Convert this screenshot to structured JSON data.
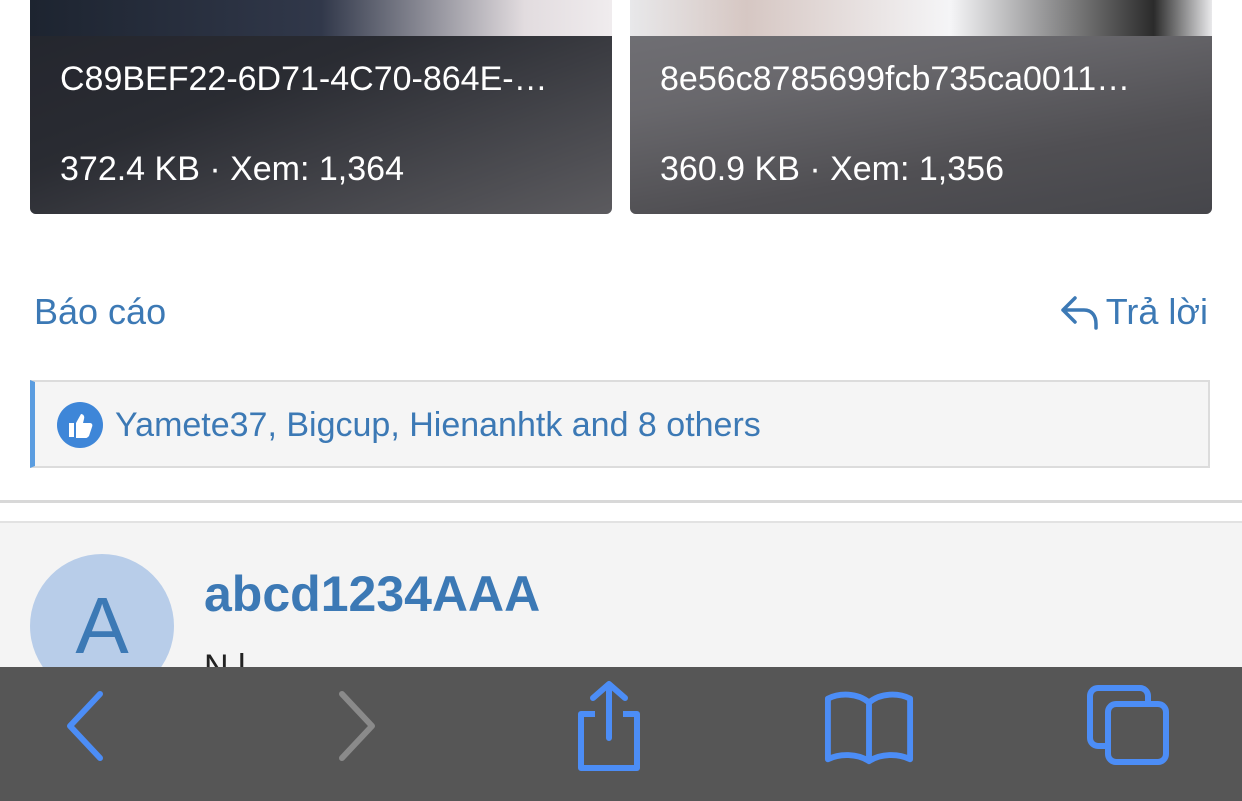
{
  "attachments": [
    {
      "name": "C89BEF22-6D71-4C70-864E-…",
      "meta": "372.4 KB · Xem: 1,364"
    },
    {
      "name": "8e56c8785699fcb735ca0011…",
      "meta": "360.9 KB · Xem: 1,356"
    }
  ],
  "actions": {
    "report_label": "Báo cáo",
    "reply_label": "Trả lời"
  },
  "likes": {
    "text": "Yamete37, Bigcup, Hienanhtk and 8 others",
    "icon": "thumbs-up-icon"
  },
  "post": {
    "avatar_letter": "A",
    "username": "abcd1234AAA",
    "user_title": "N    l"
  },
  "toolbar": {
    "icons": [
      "back-icon",
      "forward-icon",
      "share-icon",
      "bookmarks-icon",
      "tabs-icon"
    ],
    "accent": "#4c8df6",
    "disabled": "#8a8a8a"
  },
  "colors": {
    "link": "#3c79b5",
    "likes_accent": "#5b9de0"
  }
}
